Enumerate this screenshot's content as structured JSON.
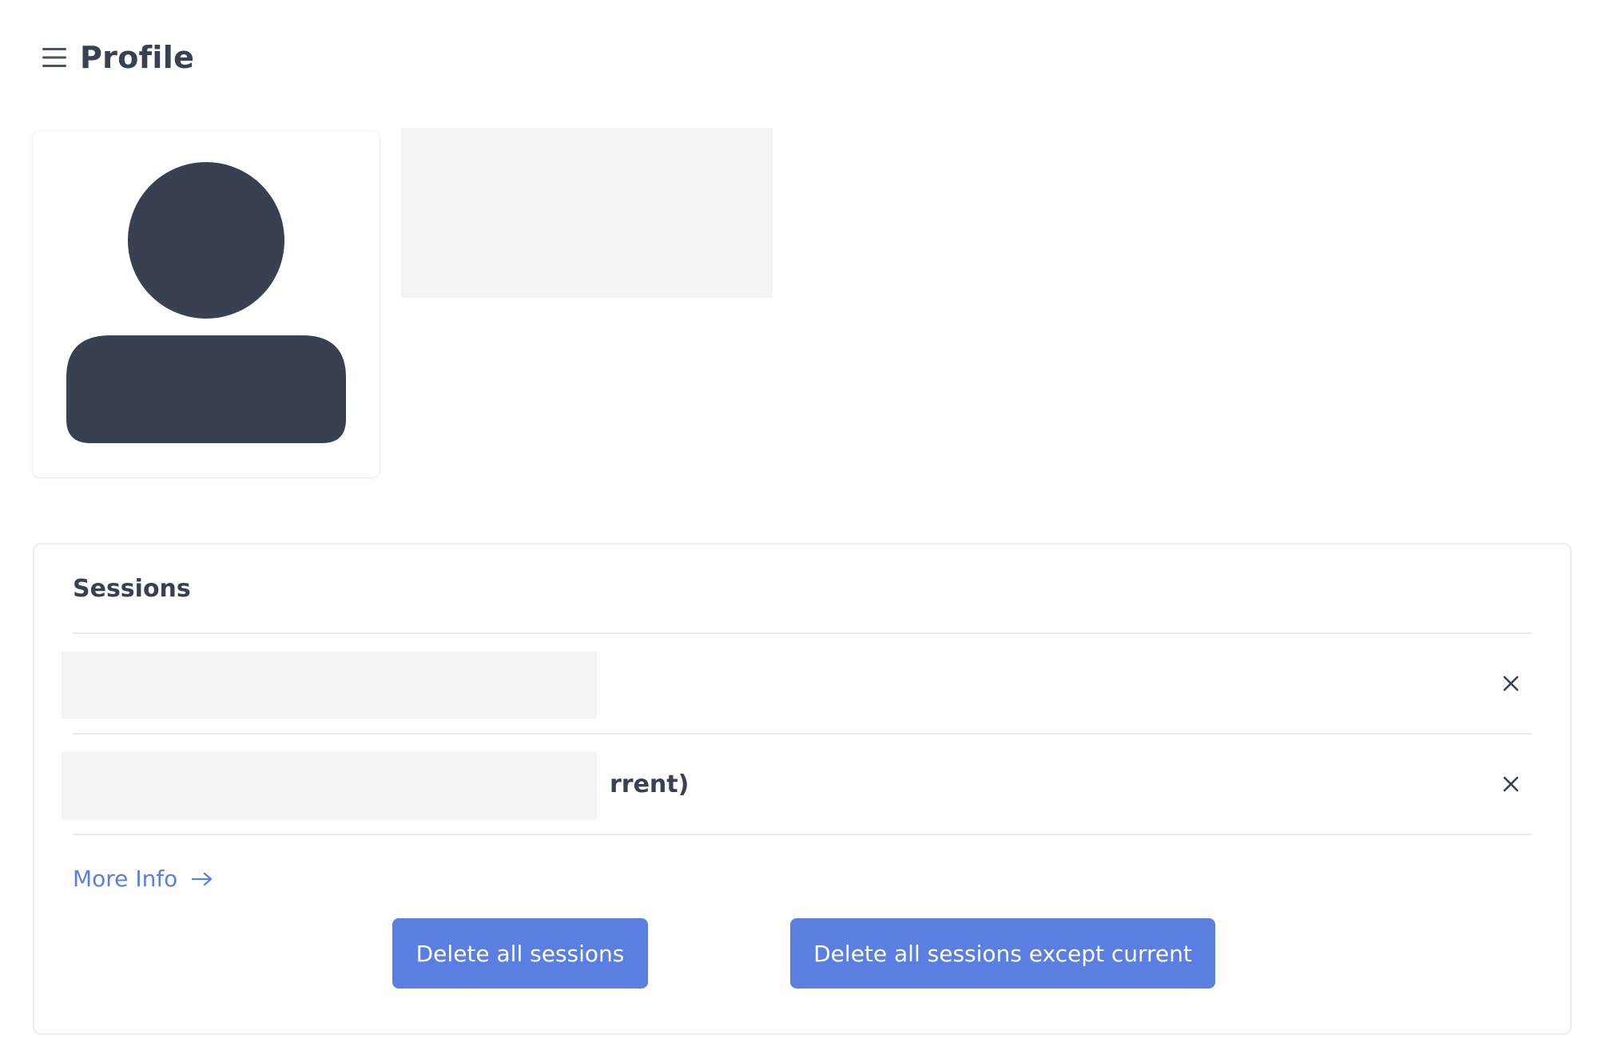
{
  "header": {
    "title": "Profile",
    "menu_icon": "hamburger-menu-icon"
  },
  "avatar": {
    "icon": "user-silhouette-icon",
    "color": "#374151"
  },
  "sessions": {
    "title": "Sessions",
    "items": [
      {
        "label": ""
      },
      {
        "label": "rrent)"
      }
    ],
    "close_icon": "close-x-icon",
    "more_info_label": "More Info",
    "more_info_icon": "arrow-right-icon",
    "delete_all_label": "Delete all sessions",
    "delete_except_label": "Delete all sessions except current"
  },
  "colors": {
    "accent": "#5a7fe0",
    "text": "#374151",
    "placeholder": "#f3f4f6"
  }
}
